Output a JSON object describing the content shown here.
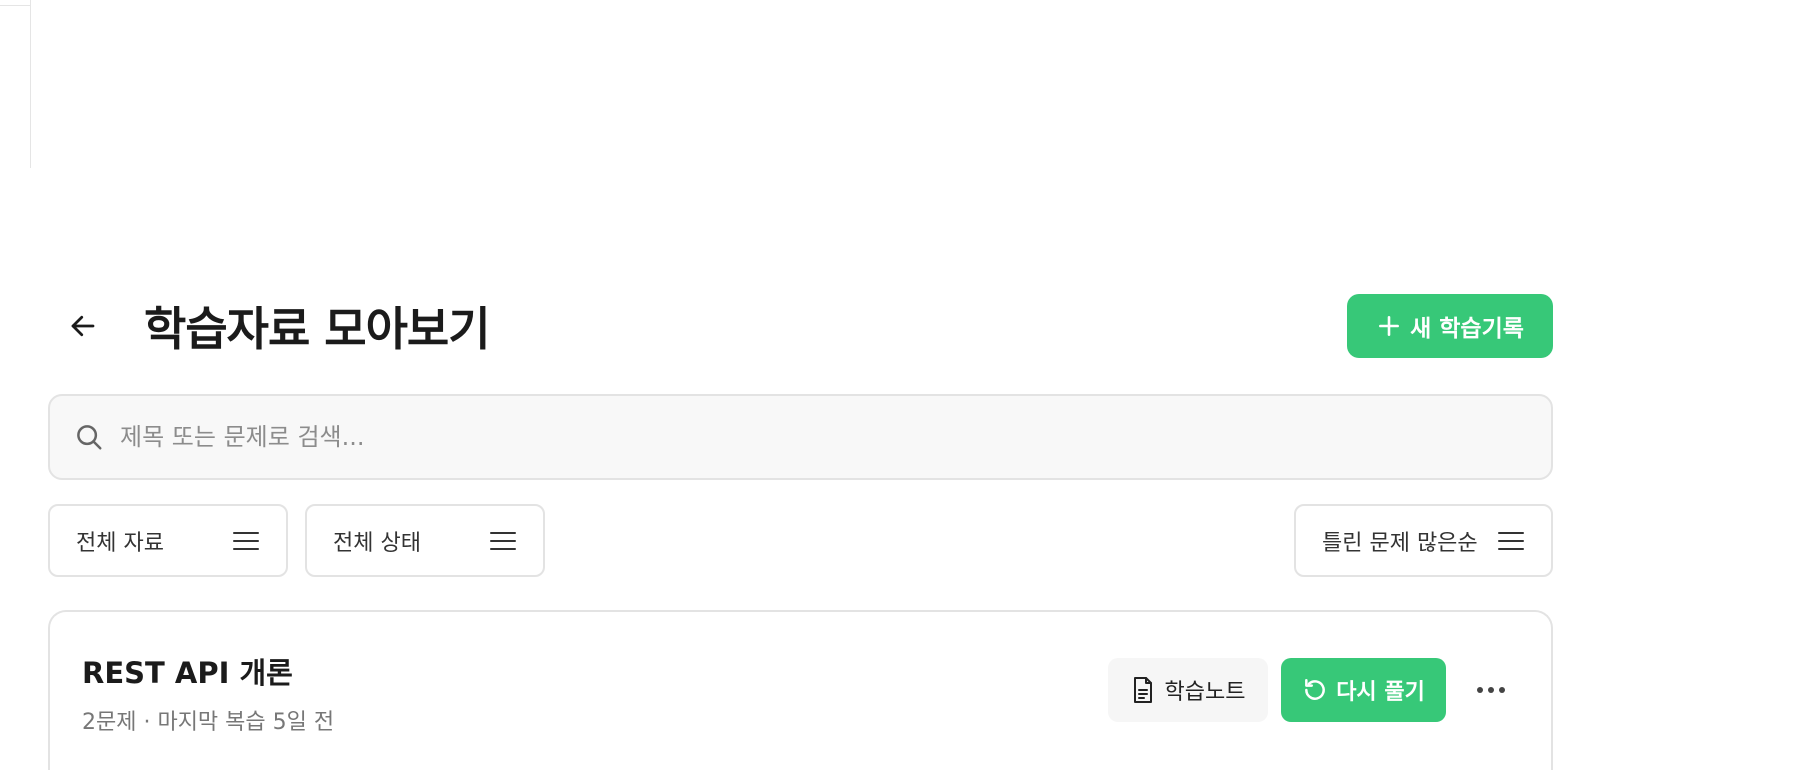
{
  "header": {
    "title": "학습자료 모아보기",
    "new_button_label": "새 학습기록"
  },
  "search": {
    "placeholder": "제목 또는 문제로 검색...",
    "value": ""
  },
  "filters": {
    "material": "전체 자료",
    "status": "전체 상태",
    "sort": "틀린 문제 많은순"
  },
  "cards": [
    {
      "title": "REST API 개론",
      "meta": "2문제 · 마지막 복습 5일 전",
      "note_label": "학습노트",
      "retry_label": "다시 풀기"
    }
  ],
  "colors": {
    "accent": "#37c878",
    "border": "#e3e3e3",
    "search_bg": "#f8f8f8"
  },
  "icons": [
    "arrow-left-icon",
    "plus-icon",
    "search-icon",
    "menu-icon",
    "document-icon",
    "refresh-icon",
    "more-horizontal-icon"
  ]
}
